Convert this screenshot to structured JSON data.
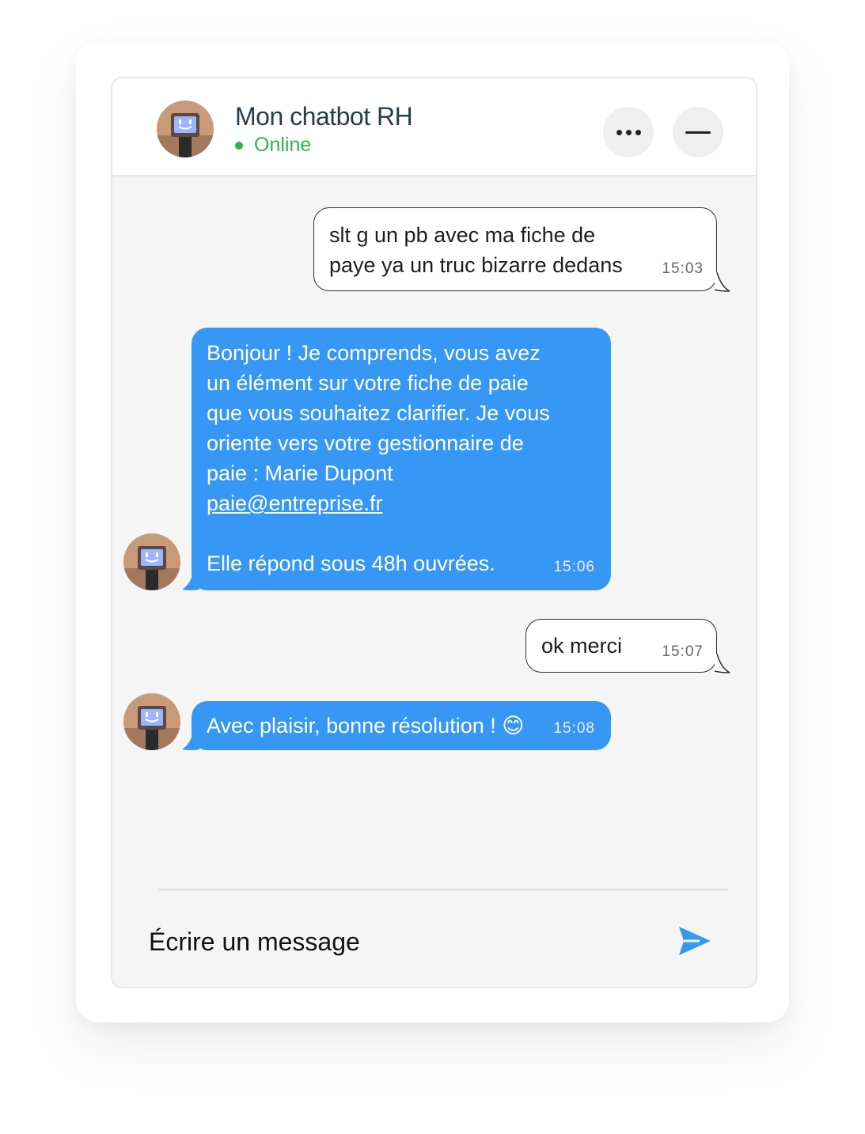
{
  "header": {
    "title": "Mon chatbot RH",
    "status": "Online",
    "status_color": "#2fb34a",
    "more_icon": "more-horizontal-icon",
    "minimize_icon": "minimize-icon"
  },
  "messages": [
    {
      "sender": "user",
      "text": "slt g un pb avec ma fiche de\npaye ya un truc bizarre dedans",
      "time": "15:03"
    },
    {
      "sender": "bot",
      "text": "Bonjour ! Je comprends, vous avez\nun élément sur votre fiche de paie\nque vous souhaitez clarifier. Je vous\noriente vers votre gestionnaire de\npaie : Marie Dupont",
      "link": "paie@entreprise.fr",
      "text_after": "Elle répond sous 48h ouvrées.",
      "time": "15:06"
    },
    {
      "sender": "user",
      "text": "ok merci",
      "time": "15:07"
    },
    {
      "sender": "bot",
      "text": "Avec plaisir, bonne résolution ! 😊",
      "time": "15:08"
    }
  ],
  "composer": {
    "placeholder": "Écrire un message",
    "send_icon": "send-icon"
  },
  "colors": {
    "bot_bubble": "#3797f5",
    "user_bubble_border": "#2d2d2d",
    "title": "#243f4a",
    "chat_background": "#f5f5f5"
  }
}
